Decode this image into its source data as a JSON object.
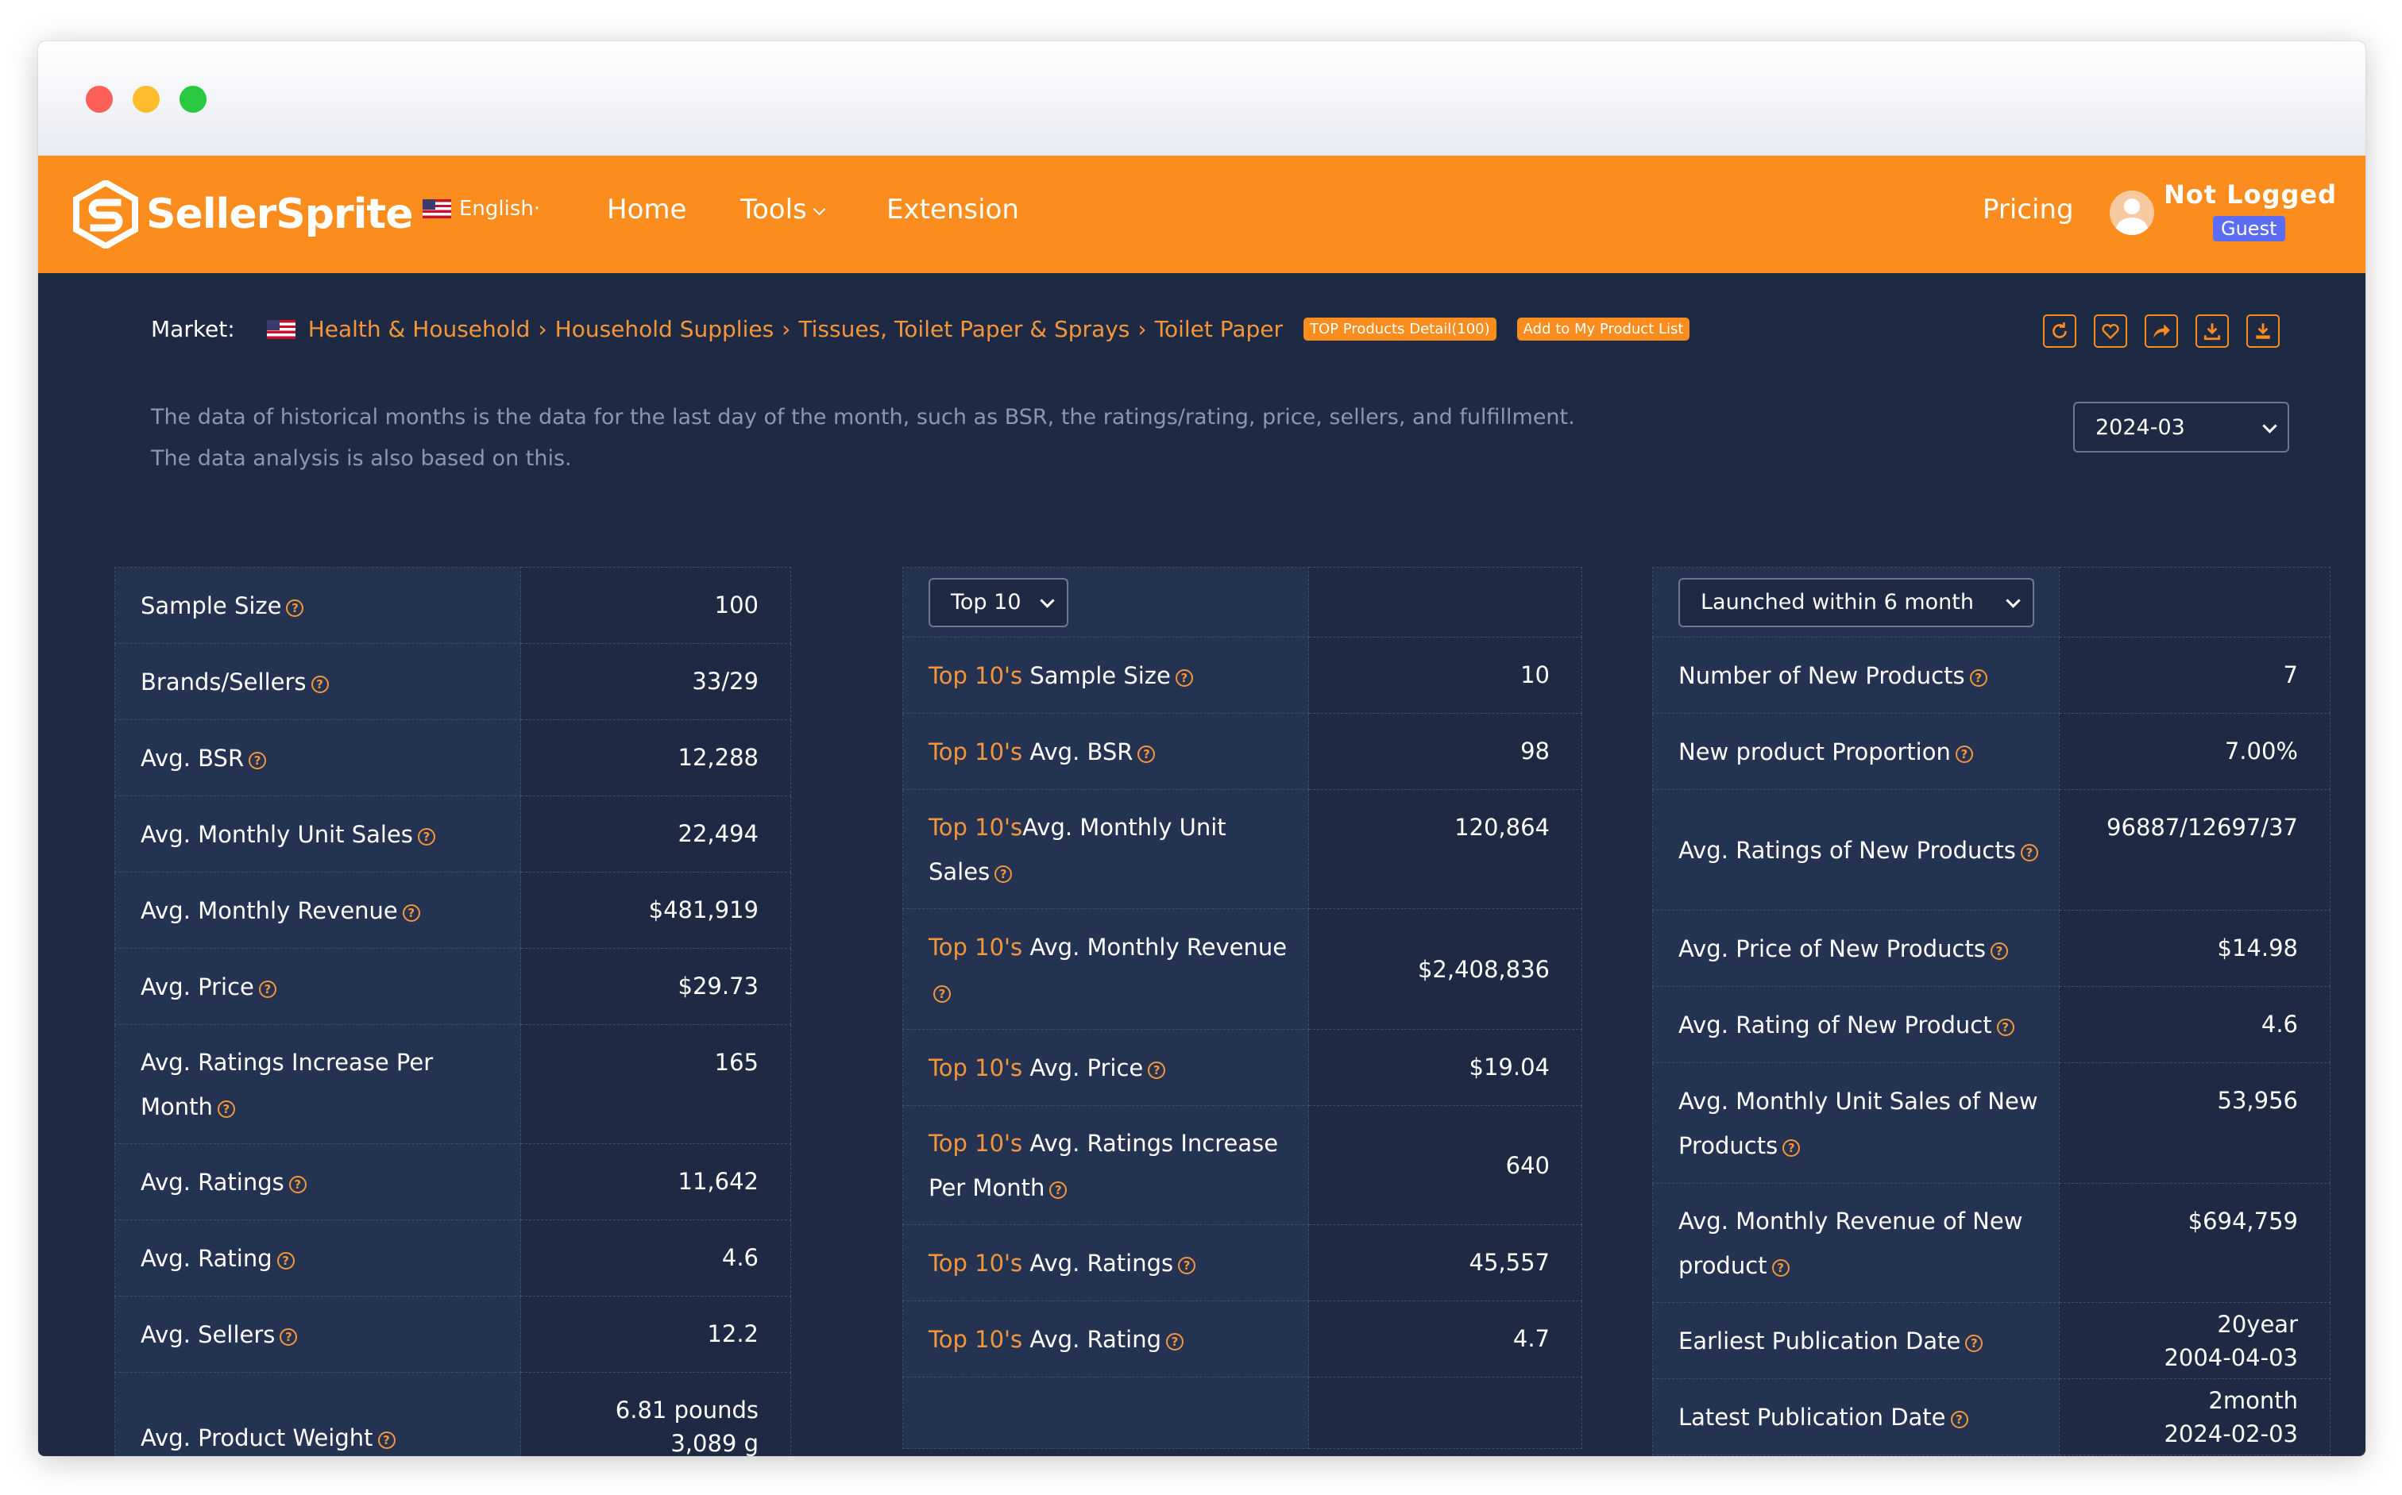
{
  "nav": {
    "brand": "SellerSprite",
    "language": "English·",
    "links": [
      {
        "label": "Home"
      },
      {
        "label": "Tools"
      },
      {
        "label": "Extension"
      }
    ],
    "pricing": "Pricing",
    "user_status": "Not Logged",
    "user_badge": "Guest",
    "colors": {
      "bar": "#fb8c1e",
      "badge": "#5b6cf5"
    }
  },
  "market": {
    "label": "Market:",
    "breadcrumb": [
      "Health & Household",
      "Household Supplies",
      "Tissues, Toilet Paper & Sprays",
      "Toilet Paper"
    ],
    "separator": "›",
    "top_products_button": "TOP Products Detail(100)",
    "add_list_button": "Add to My Product List",
    "toolbar_icons": [
      "refresh-icon",
      "heart-icon",
      "share-icon",
      "download-icon",
      "export-icon"
    ]
  },
  "note": {
    "line1": "The data of historical months is the data for the last day of the month, such as BSR, the ratings/rating, price, sellers, and fulfillment.",
    "line2": "The data analysis is also based on this."
  },
  "month_select": {
    "value": "2024-03"
  },
  "general": {
    "rows": [
      {
        "label": "Sample Size",
        "value": "100"
      },
      {
        "label": "Brands/Sellers",
        "value": "33/29"
      },
      {
        "label": "Avg. BSR",
        "value": "12,288"
      },
      {
        "label": "Avg. Monthly Unit Sales",
        "value": "22,494"
      },
      {
        "label": "Avg. Monthly Revenue",
        "value": "$481,919"
      },
      {
        "label": "Avg. Price",
        "value": "$29.73"
      },
      {
        "label": "Avg. Ratings Increase Per Month",
        "value": "165"
      },
      {
        "label": "Avg. Ratings",
        "value": "11,642"
      },
      {
        "label": "Avg. Rating",
        "value": "4.6"
      },
      {
        "label": "Avg. Sellers",
        "value": "12.2"
      },
      {
        "label": "Avg. Product Weight",
        "value": "6.81 pounds",
        "value2": "3,089 g"
      }
    ]
  },
  "top": {
    "select": "Top 10",
    "prefix": "Top 10's",
    "rows": [
      {
        "label": " Sample Size",
        "value": "10"
      },
      {
        "label": " Avg. BSR",
        "value": "98"
      },
      {
        "label": "Avg. Monthly Unit Sales",
        "value": "120,864"
      },
      {
        "label": " Avg. Monthly Revenue",
        "value": "$2,408,836"
      },
      {
        "label": " Avg. Price",
        "value": "$19.04"
      },
      {
        "label": " Avg. Ratings Increase Per Month",
        "value": "640"
      },
      {
        "label": " Avg. Ratings",
        "value": "45,557"
      },
      {
        "label": " Avg. Rating",
        "value": "4.7"
      }
    ]
  },
  "newp": {
    "select": "Launched within 6 month",
    "rows": [
      {
        "label": "Number of New Products",
        "value": "7"
      },
      {
        "label": "New product Proportion",
        "value": "7.00%"
      },
      {
        "label": "Avg. Ratings of New Products",
        "value": "96887/12697/37"
      },
      {
        "label": "Avg. Price of New Products",
        "value": "$14.98"
      },
      {
        "label": "Avg. Rating of New Product",
        "value": "4.6"
      },
      {
        "label": "Avg. Monthly Unit Sales of New Products",
        "value": "53,956"
      },
      {
        "label": "Avg. Monthly Revenue of New product",
        "value": "$694,759"
      },
      {
        "label": "Earliest Publication Date",
        "value": "20year",
        "value2": "2004-04-03"
      },
      {
        "label": "Latest Publication Date",
        "value": "2month",
        "value2": "2024-02-03"
      }
    ]
  }
}
